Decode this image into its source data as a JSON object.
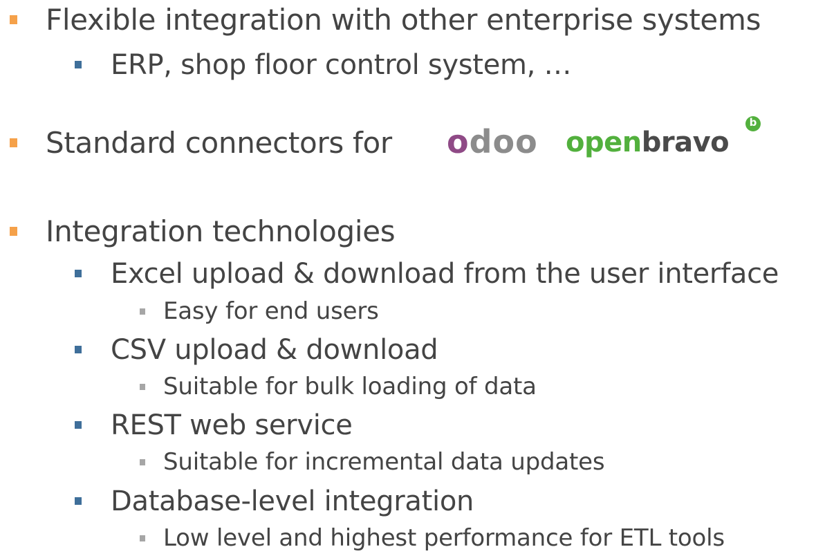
{
  "colors": {
    "level1_bullet": "#f5a14a",
    "level2_bullet": "#3f6f9a",
    "level3_bullet": "#a6a6a6",
    "text": "#444444",
    "odoo_purple": "#8f4a86",
    "odoo_gray": "#8c8c8c",
    "openbravo_green": "#52b03d",
    "openbravo_dark": "#4a4a4a"
  },
  "items": [
    {
      "level": 1,
      "text": "Flexible integration with other enterprise systems"
    },
    {
      "level": 2,
      "text": "ERP, shop floor control system, …"
    },
    {
      "level": 1,
      "text": "Standard connectors for"
    },
    {
      "level": 1,
      "text": "Integration technologies"
    },
    {
      "level": 2,
      "text": "Excel upload & download from the user interface"
    },
    {
      "level": 3,
      "text": "Easy for end users"
    },
    {
      "level": 2,
      "text": "CSV upload & download"
    },
    {
      "level": 3,
      "text": "Suitable for bulk loading of data"
    },
    {
      "level": 2,
      "text": "REST web service"
    },
    {
      "level": 3,
      "text": "Suitable for incremental data updates"
    },
    {
      "level": 2,
      "text": "Database-level integration"
    },
    {
      "level": 3,
      "text": "Low level and highest performance for ETL tools"
    }
  ],
  "logos": {
    "odoo": {
      "o1": "o",
      "rest": "doo"
    },
    "openbravo": {
      "open": "open",
      "bravo": "bravo",
      "mark": "b"
    }
  }
}
